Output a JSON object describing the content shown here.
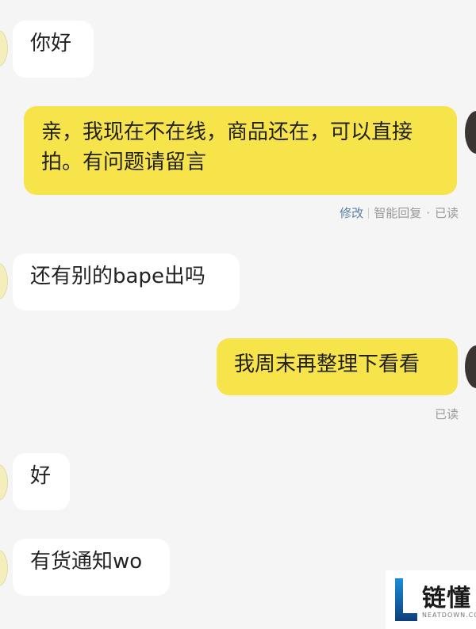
{
  "messages": [
    {
      "side": "in",
      "text": "你好"
    },
    {
      "side": "out",
      "text": "亲，我现在不在线，商品还在，可以直接拍。有问题请留言"
    },
    {
      "side": "in",
      "text": "还有别的bape出吗"
    },
    {
      "side": "out",
      "text": "我周末再整理下看看"
    },
    {
      "side": "in",
      "text": "好"
    },
    {
      "side": "in",
      "text": "有货通知wo"
    }
  ],
  "meta1": {
    "edit": "修改",
    "auto_reply": "智能回复",
    "dot": "·",
    "read": "已读"
  },
  "meta2": {
    "read": "已读"
  },
  "watermark": {
    "title": "链懂",
    "sub": "NEATDOWN.COM"
  },
  "colors": {
    "background": "#f5f5f5",
    "outgoing_bubble": "#f7e34a",
    "incoming_bubble": "#ffffff",
    "edit_link": "#5b7fa6"
  }
}
